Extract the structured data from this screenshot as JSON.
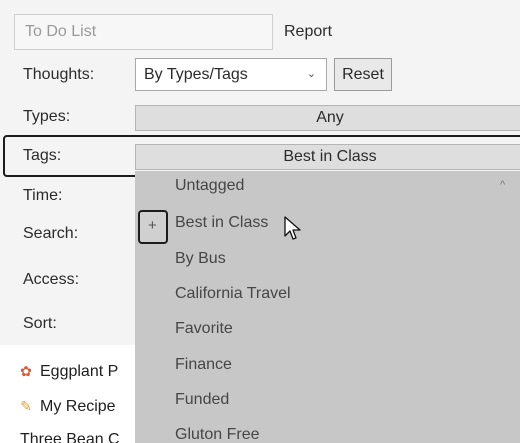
{
  "tabs": {
    "todo": "To Do List",
    "report": "Report"
  },
  "rows": {
    "thoughts": "Thoughts:",
    "types": "Types:",
    "tags": "Tags:",
    "time": "Time:",
    "search": "Search:",
    "access": "Access:",
    "sort": "Sort:"
  },
  "thoughts_select": {
    "value": "By Types/Tags",
    "chevron": "⌄"
  },
  "reset_label": "Reset",
  "types_value": "Any",
  "tags_value": "Best in Class",
  "dropdown": {
    "items": [
      "Untagged",
      "Best in Class",
      "By Bus",
      "California Travel",
      "Favorite",
      "Finance",
      "Funded",
      "Gluton Free"
    ],
    "plus": "+",
    "scroll_up": "^"
  },
  "list": [
    {
      "icon": "award-icon",
      "label": "Eggplant P"
    },
    {
      "icon": "pencil-icon",
      "label": "My Recipe"
    },
    {
      "icon": "",
      "label": "Three Bean C"
    }
  ],
  "colors": {
    "dropdown_bg": "#c7c7c7",
    "bar_bg": "#dedede",
    "highlight_border": "#1c1c1c"
  }
}
